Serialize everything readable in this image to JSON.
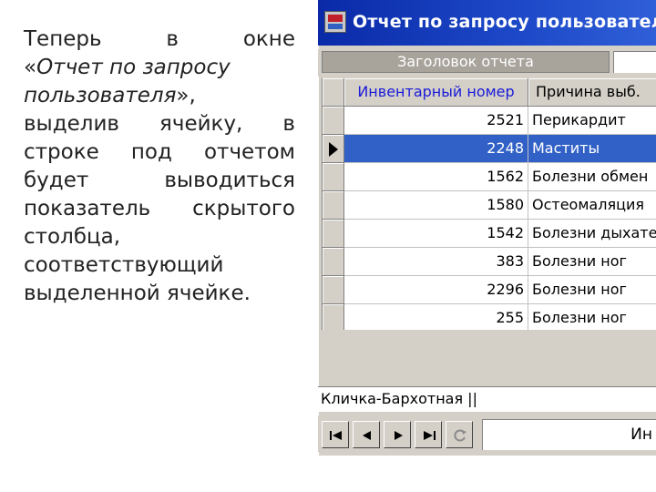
{
  "paragraph": {
    "lines": [
      [
        "Теперь",
        "в",
        "окне"
      ],
      [
        "«",
        "Отчет по запросу"
      ],
      [
        "пользователя",
        "»,"
      ],
      [
        "выделив",
        "ячейку,",
        "в"
      ],
      [
        "строке",
        "под",
        "отчетом"
      ],
      [
        "будет",
        "выводиться"
      ],
      [
        "показатель",
        "скрытого"
      ],
      [
        "столбца,"
      ],
      [
        "соответствующий"
      ],
      [
        "выделенной ячейке."
      ]
    ]
  },
  "window": {
    "title": "Отчет по запросу пользовател",
    "header_caption": "Заголовок отчета"
  },
  "grid": {
    "columns": [
      "Инвентарный номер",
      "Причина выб."
    ],
    "rows": [
      {
        "num": "2521",
        "reason": "Перикардит"
      },
      {
        "num": "2248",
        "reason": "Маститы"
      },
      {
        "num": "1562",
        "reason": "Болезни обмен"
      },
      {
        "num": "1580",
        "reason": "Остеомаляция"
      },
      {
        "num": "1542",
        "reason": "Болезни дыхате"
      },
      {
        "num": "383",
        "reason": "Болезни ног"
      },
      {
        "num": "2296",
        "reason": "Болезни ног"
      },
      {
        "num": "255",
        "reason": "Болезни ног"
      }
    ],
    "selected_row": 1
  },
  "status": {
    "text": "Кличка-Бархотная ||"
  },
  "navigator": {
    "field_text": "Ин",
    "buttons": [
      "first-record-icon",
      "prev-record-icon",
      "next-record-icon",
      "last-record-icon",
      "refresh-icon"
    ]
  },
  "colors": {
    "title_bar": "#1d49c8",
    "selection": "#3161c6",
    "header_text": "#1a1ad8",
    "face": "#d4d0c8"
  }
}
